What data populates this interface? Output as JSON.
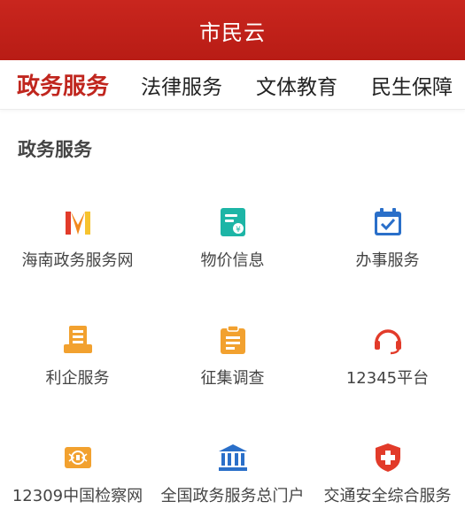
{
  "header": {
    "title": "市民云"
  },
  "tabs": [
    {
      "label": "政务服务"
    },
    {
      "label": "法律服务"
    },
    {
      "label": "文体教育"
    },
    {
      "label": "民生保障"
    }
  ],
  "section": {
    "title": "政务服务",
    "items": [
      {
        "label": "海南政务服务网",
        "icon": "hainan-logo-icon"
      },
      {
        "label": "物价信息",
        "icon": "price-document-icon"
      },
      {
        "label": "办事服务",
        "icon": "calendar-check-icon"
      },
      {
        "label": "利企服务",
        "icon": "enterprise-service-icon"
      },
      {
        "label": "征集调查",
        "icon": "clipboard-icon"
      },
      {
        "label": "12345平台",
        "icon": "headset-icon"
      },
      {
        "label": "12309中国检察网",
        "icon": "procuratorate-badge-icon"
      },
      {
        "label": "全国政务服务总门户",
        "icon": "government-building-icon"
      },
      {
        "label": "交通安全综合服务",
        "icon": "shield-plus-icon"
      }
    ]
  },
  "colors": {
    "brand_red": "#c0261e",
    "icon_blue": "#2a6fc9",
    "icon_orange": "#f2a12f",
    "icon_teal": "#1db5a6"
  }
}
